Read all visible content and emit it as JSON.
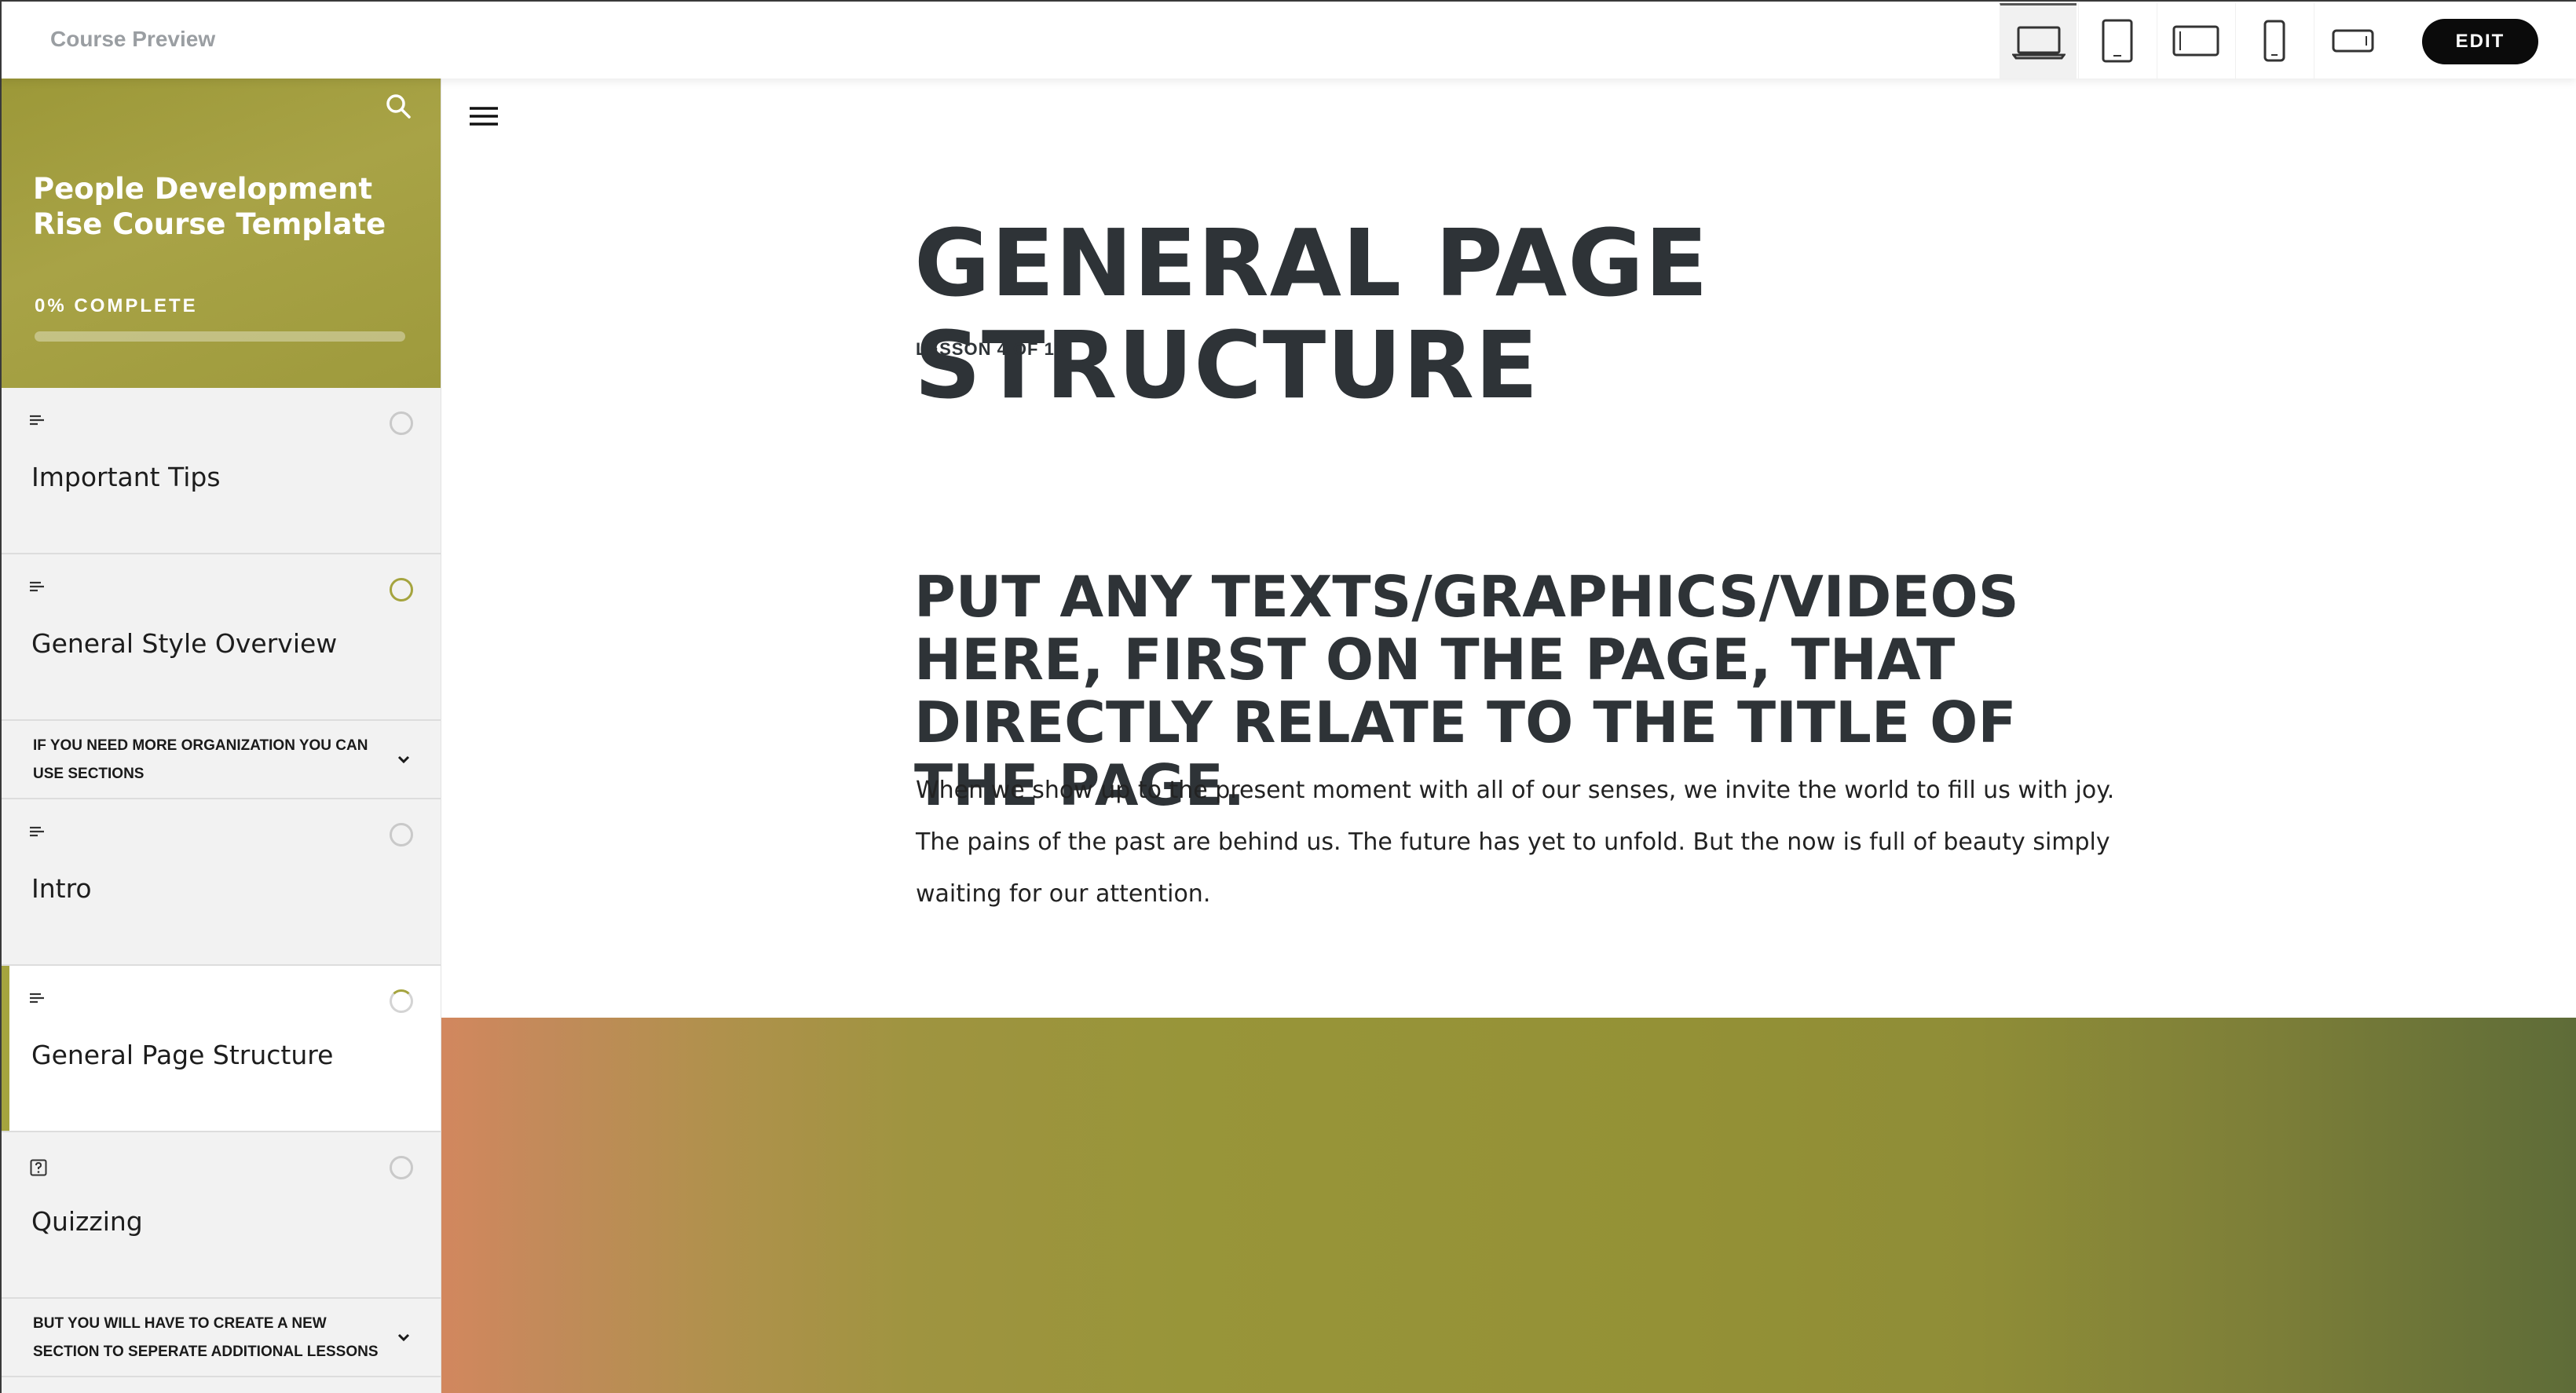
{
  "topbar": {
    "title": "Course Preview",
    "devices": [
      {
        "name": "laptop",
        "active": true
      },
      {
        "name": "tablet-portrait",
        "active": false
      },
      {
        "name": "tablet-landscape",
        "active": false
      },
      {
        "name": "phone-portrait",
        "active": false
      },
      {
        "name": "phone-landscape",
        "active": false
      }
    ],
    "edit_label": "EDIT"
  },
  "sidebar": {
    "course_title": "People Development Rise Course Template",
    "progress_label": "0% COMPLETE",
    "progress_percent": 0,
    "accent_color": "#a5a43e",
    "items": [
      {
        "type": "lesson",
        "icon": "text-lines-icon",
        "title": "Important Tips",
        "status": "not-started"
      },
      {
        "type": "lesson",
        "icon": "text-lines-icon",
        "title": "General Style Overview",
        "status": "in-progress"
      },
      {
        "type": "section",
        "title": "IF YOU NEED MORE ORGANIZATION YOU CAN USE SECTIONS"
      },
      {
        "type": "lesson",
        "icon": "text-lines-icon",
        "title": "Intro",
        "status": "not-started"
      },
      {
        "type": "lesson",
        "icon": "text-lines-icon",
        "title": "General Page Structure",
        "status": "partial",
        "active": true
      },
      {
        "type": "lesson",
        "icon": "quiz-icon",
        "title": "Quizzing",
        "status": "not-started"
      },
      {
        "type": "section",
        "title": "BUT YOU WILL HAVE TO CREATE A NEW SECTION TO SEPERATE ADDITIONAL LESSONS"
      }
    ]
  },
  "main": {
    "page_title": "GENERAL PAGE STRUCTURE",
    "lesson_count": "LESSON 4 OF 11",
    "heading": "PUT ANY TEXTS/GRAPHICS/VIDEOS HERE, FIRST ON THE PAGE, THAT DIRECTLY RELATE TO THE TITLE OF THE PAGE.",
    "paragraph": "When we show up to the present moment with all of our senses, we invite the world to fill us with joy. The pains of the past are behind us. The future has yet to unfold. But the now is full of beauty simply waiting for our attention."
  }
}
